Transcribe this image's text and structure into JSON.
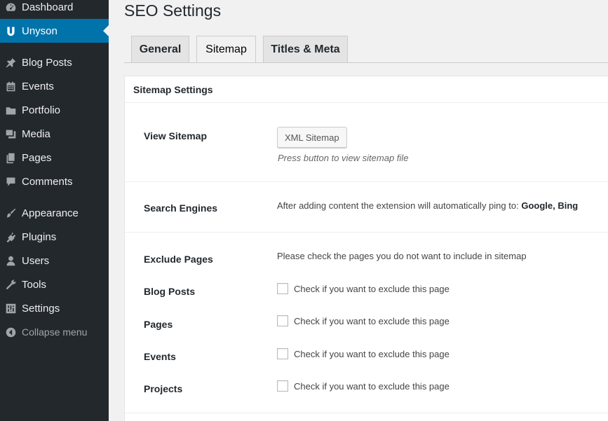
{
  "sidebar": {
    "items": [
      {
        "label": "Dashboard",
        "icon": "dashboard-icon"
      },
      {
        "label": "Unyson",
        "icon": "unyson-icon"
      },
      {
        "label": "Blog Posts",
        "icon": "pin-icon"
      },
      {
        "label": "Events",
        "icon": "calendar-icon"
      },
      {
        "label": "Portfolio",
        "icon": "folder-icon"
      },
      {
        "label": "Media",
        "icon": "media-icon"
      },
      {
        "label": "Pages",
        "icon": "pages-icon"
      },
      {
        "label": "Comments",
        "icon": "comment-icon"
      },
      {
        "label": "Appearance",
        "icon": "brush-icon"
      },
      {
        "label": "Plugins",
        "icon": "plugin-icon"
      },
      {
        "label": "Users",
        "icon": "user-icon"
      },
      {
        "label": "Tools",
        "icon": "wrench-icon"
      },
      {
        "label": "Settings",
        "icon": "settings-icon"
      },
      {
        "label": "Collapse menu",
        "icon": "collapse-icon"
      }
    ],
    "active": "Unyson",
    "active_color": "#0073aa",
    "background": "#23282d"
  },
  "page": {
    "title": "SEO Settings",
    "tabs": [
      {
        "label": "General"
      },
      {
        "label": "Sitemap"
      },
      {
        "label": "Titles & Meta"
      }
    ],
    "active_tab": "Sitemap"
  },
  "panel": {
    "title": "Sitemap Settings",
    "view_sitemap": {
      "label": "View Sitemap",
      "button": "XML Sitemap",
      "description": "Press button to view sitemap file"
    },
    "search_engines": {
      "label": "Search Engines",
      "text": "After adding content the extension will automatically ping to:",
      "engines": "Google, Bing"
    },
    "exclude_pages": {
      "label": "Exclude Pages",
      "text": "Please check the pages you do not want to include in sitemap",
      "checkbox_text": "Check if you want to exclude this page",
      "rows": [
        {
          "label": "Blog Posts",
          "checked": false
        },
        {
          "label": "Pages",
          "checked": false
        },
        {
          "label": "Events",
          "checked": false
        },
        {
          "label": "Projects",
          "checked": false
        }
      ]
    }
  }
}
